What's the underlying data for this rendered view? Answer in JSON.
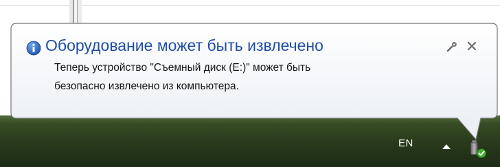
{
  "balloon": {
    "title": "Оборудование может быть извлечено",
    "message_line1": "Теперь устройство \"Съемный диск (E:)\" может быть",
    "message_line2": "безопасно извлечено из компьютера.",
    "icons": {
      "info": "info-icon",
      "options": "wrench-icon",
      "close": "close-icon"
    }
  },
  "taskbar": {
    "language": "EN",
    "show_hidden_icons": "up-arrow-icon",
    "tray_icon": "usb-drive-safe-remove-icon"
  },
  "colors": {
    "title": "#1f4ea3",
    "taskbar": "#2f4220",
    "balloon_border": "#767676"
  }
}
